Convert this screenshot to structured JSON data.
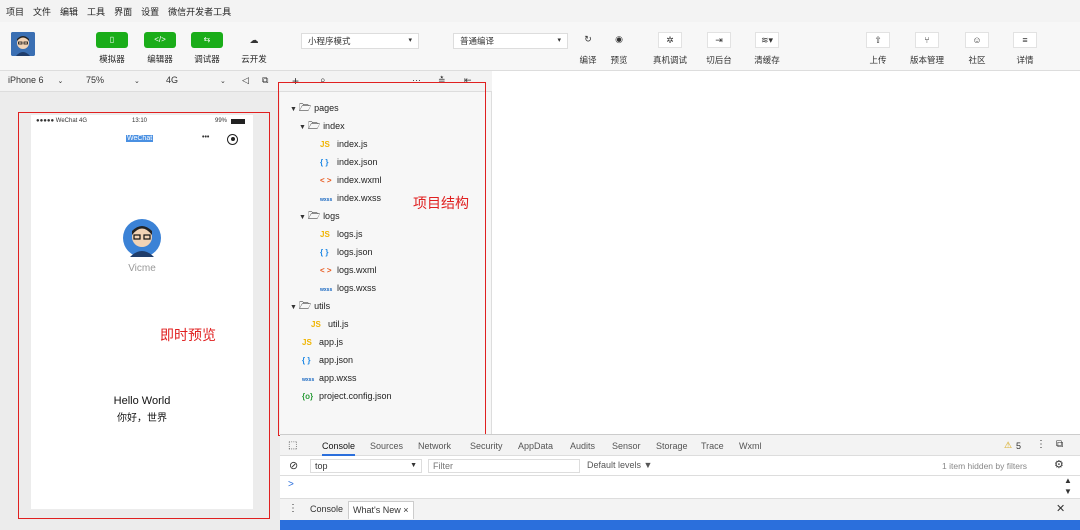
{
  "menu": [
    "项目",
    "文件",
    "编辑",
    "工具",
    "界面",
    "设置",
    "微信开发者工具"
  ],
  "toolbar": {
    "simulator": "模拟器",
    "editor": "编辑器",
    "debugger": "调试器",
    "cloud": "云开发",
    "mode": "小程序模式",
    "compile_mode": "普通编译",
    "compile": "编译",
    "preview": "预览",
    "remote_debug": "真机调试",
    "background": "切后台",
    "clear_cache": "清缓存",
    "upload": "上传",
    "version": "版本管理",
    "community": "社区",
    "details": "详情"
  },
  "device": {
    "model": "iPhone 6",
    "zoom": "75%",
    "network": "4G"
  },
  "phone": {
    "carrier": "●●●●● WeChat 4G",
    "time": "13:10",
    "battery": "99%",
    "nav_title": "WeChat",
    "nav_more": "•••",
    "nickname": "Vicme",
    "hello": "Hello World",
    "hello_cn": "你好，世界"
  },
  "annotations": {
    "preview": "即时预览",
    "structure": "项目结构"
  },
  "tree": [
    {
      "icon": "folder",
      "label": "pages",
      "depth": 0,
      "expanded": true
    },
    {
      "icon": "folder",
      "label": "index",
      "depth": 1,
      "expanded": true
    },
    {
      "icon": "js",
      "label": "index.js",
      "depth": 2
    },
    {
      "icon": "json",
      "label": "index.json",
      "depth": 2
    },
    {
      "icon": "wxml",
      "label": "index.wxml",
      "depth": 2
    },
    {
      "icon": "wxss",
      "label": "index.wxss",
      "depth": 2
    },
    {
      "icon": "folder",
      "label": "logs",
      "depth": 1,
      "expanded": true
    },
    {
      "icon": "js",
      "label": "logs.js",
      "depth": 2
    },
    {
      "icon": "json",
      "label": "logs.json",
      "depth": 2
    },
    {
      "icon": "wxml",
      "label": "logs.wxml",
      "depth": 2
    },
    {
      "icon": "wxss",
      "label": "logs.wxss",
      "depth": 2
    },
    {
      "icon": "folder",
      "label": "utils",
      "depth": 0,
      "expanded": true
    },
    {
      "icon": "js",
      "label": "util.js",
      "depth": 1
    },
    {
      "icon": "js",
      "label": "app.js",
      "depth": 0
    },
    {
      "icon": "json",
      "label": "app.json",
      "depth": 0
    },
    {
      "icon": "wxss",
      "label": "app.wxss",
      "depth": 0
    },
    {
      "icon": "cfg",
      "label": "project.config.json",
      "depth": 0
    }
  ],
  "icon_glyphs": {
    "js": "JS",
    "json": "{ }",
    "wxml": "< >",
    "wxss": "wxss",
    "cfg": "{o}"
  },
  "devtools": {
    "tabs": [
      "Console",
      "Sources",
      "Network",
      "Security",
      "AppData",
      "Audits",
      "Sensor",
      "Storage",
      "Trace",
      "Wxml"
    ],
    "warning_count": "5",
    "context": "top",
    "filter_placeholder": "Filter",
    "levels": "Default levels ▼",
    "hidden": "1 item hidden by filters",
    "prompt": ">",
    "drawer_tabs": [
      "Console",
      "What's New ×"
    ]
  },
  "colors": {
    "green": "#1aad19",
    "annotation_red": "#e02020",
    "accent_blue": "#2b6fdc"
  }
}
